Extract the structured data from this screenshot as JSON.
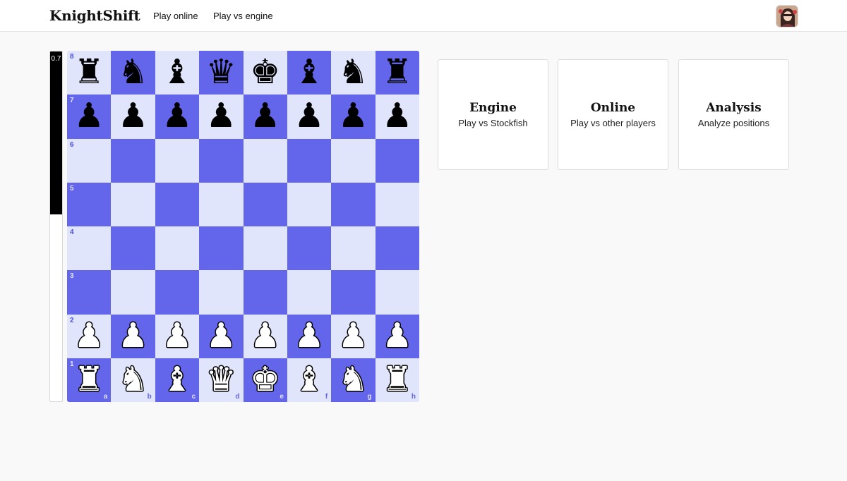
{
  "header": {
    "brand": "KnightShift",
    "nav": [
      {
        "label": "Play online"
      },
      {
        "label": "Play vs engine"
      }
    ]
  },
  "eval": {
    "label": "0.7",
    "black_fraction": 0.465
  },
  "board": {
    "files": [
      "a",
      "b",
      "c",
      "d",
      "e",
      "f",
      "g",
      "h"
    ],
    "ranks": [
      "8",
      "7",
      "6",
      "5",
      "4",
      "3",
      "2",
      "1"
    ],
    "rows": [
      [
        "♜",
        "♞",
        "♝",
        "♛",
        "♚",
        "♝",
        "♞",
        "♜"
      ],
      [
        "♟",
        "♟",
        "♟",
        "♟",
        "♟",
        "♟",
        "♟",
        "♟"
      ],
      [
        "",
        "",
        "",
        "",
        "",
        "",
        "",
        ""
      ],
      [
        "",
        "",
        "",
        "",
        "",
        "",
        "",
        ""
      ],
      [
        "",
        "",
        "",
        "",
        "",
        "",
        "",
        ""
      ],
      [
        "",
        "",
        "",
        "",
        "",
        "",
        "",
        ""
      ],
      [
        "♟",
        "♟",
        "♟",
        "♟",
        "♟",
        "♟",
        "♟",
        "♟"
      ],
      [
        "♜",
        "♞",
        "♝",
        "♛",
        "♚",
        "♝",
        "♞",
        "♜"
      ]
    ],
    "colors": {
      "light": "#e1e5fb",
      "dark": "#6366eb"
    }
  },
  "cards": [
    {
      "title": "Engine",
      "subtitle": "Play vs Stockfish"
    },
    {
      "title": "Online",
      "subtitle": "Play vs other players"
    },
    {
      "title": "Analysis",
      "subtitle": "Analyze positions"
    }
  ]
}
